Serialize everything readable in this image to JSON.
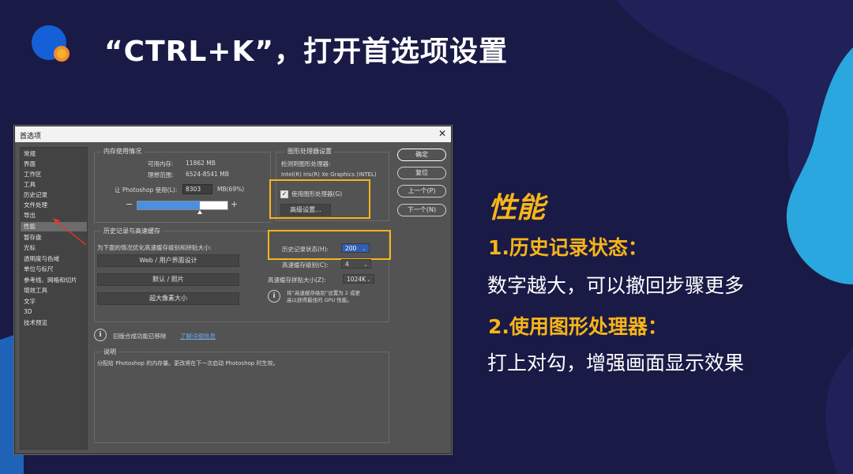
{
  "slide": {
    "title": "“CTRL+K”，打开首选项设置",
    "side_heading": "性能",
    "point1_heading": "1.历史记录状态：",
    "point1_text": "数字越大，可以撤回步骤更多",
    "point2_heading": "2.使用图形处理器：",
    "point2_text": "打上对勾，增强画面显示效果",
    "colors": {
      "background": "#1a1a46",
      "accent": "#f7b518",
      "wave": "#2aa7de",
      "logo_blue": "#1560d6",
      "logo_orange": "#f58a2a"
    }
  },
  "dialog": {
    "title": "首选项",
    "close_glyph": "✕",
    "nav_items": [
      "常规",
      "界面",
      "工作区",
      "工具",
      "历史记录",
      "文件处理",
      "导出",
      "性能",
      "暂存盘",
      "光标",
      "透明度与色域",
      "单位与标尺",
      "参考线、网格和切片",
      "增效工具",
      "文字",
      "3D",
      "技术预览"
    ],
    "selected_nav": "性能",
    "buttons": {
      "ok": "确定",
      "reset": "复位",
      "prev": "上一个(P)",
      "next": "下一个(N)"
    },
    "memory": {
      "group_label": "内存使用情况",
      "available_label": "可用内存:",
      "available_value": "11862 MB",
      "ideal_label": "理想范围:",
      "ideal_value": "6524-8541 MB",
      "let_use_label": "让 Photoshop 使用(L):",
      "let_use_value": "8303",
      "unit_pct": "MB(69%)",
      "minus": "−",
      "plus": "+",
      "slider_fraction": 0.69
    },
    "gpu": {
      "group_label": "图形处理器设置",
      "detected_label": "检测到图形处理器:",
      "gpu_name": "Intel(R) Iris(R) Xe Graphics (INTEL)",
      "use_gpu_label": "使用图形处理器(G)",
      "use_gpu_checked": true,
      "advanced_button": "高级设置..."
    },
    "history": {
      "group_label": "历史记录与高速缓存",
      "optimize_label": "为下面的情况优化高速缓存级别和拼贴大小:",
      "option_buttons": [
        "Web / 用户界面设计",
        "默认 / 照片",
        "超大像素大小"
      ],
      "states_label": "历史记录状态(H):",
      "states_value": "200",
      "cache_levels_label": "高速缓存级别(C):",
      "cache_levels_value": "4",
      "tile_size_label": "高速缓存拼贴大小(Z):",
      "tile_size_value": "1024K",
      "note_line1": "将“高速缓存级别”设置为 2 或更",
      "note_line2": "高以获得最佳的 GPU 性能。"
    },
    "legacy_notice": "旧版合成功能已移除",
    "legacy_link": "了解详细信息",
    "description": {
      "group_label": "说明",
      "text": "分配给 Photoshop 的内存量。更改将在下一次启动 Photoshop 时生效。"
    }
  }
}
